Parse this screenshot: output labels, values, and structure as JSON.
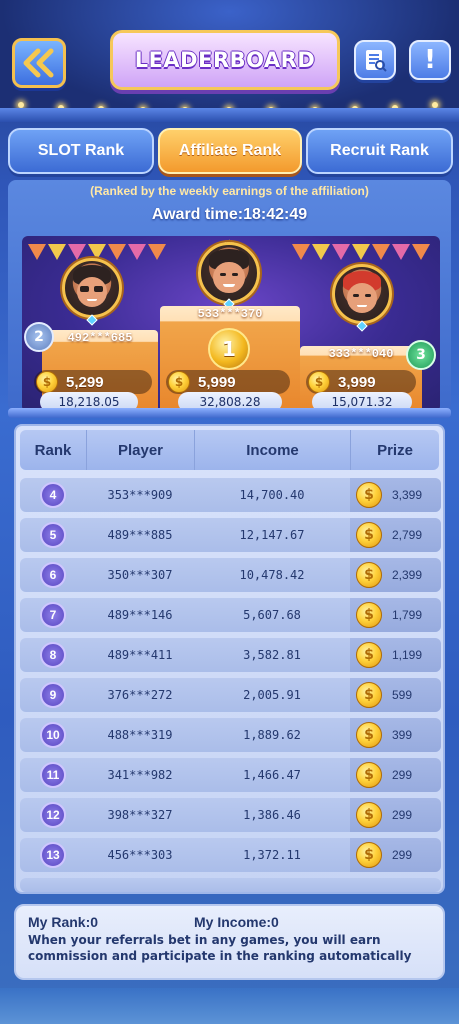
{
  "header": {
    "title": "LEADERBOARD",
    "back_icon": "double-chevron-left-icon",
    "rules_icon": "rules-list-icon",
    "info_icon": "exclamation-icon"
  },
  "tabs": [
    {
      "label": "SLOT Rank",
      "active": false
    },
    {
      "label": "Affiliate Rank",
      "active": true
    },
    {
      "label": "Recruit Rank",
      "active": false
    }
  ],
  "subtitle": "(Ranked by the weekly earnings of the affiliation)",
  "award_time": "Award time:18:42:49",
  "podium": {
    "first": {
      "rank": "1",
      "player": "533***370",
      "prize": "5,999",
      "income": "32,808.28"
    },
    "second": {
      "rank": "2",
      "player": "492***685",
      "prize": "5,299",
      "income": "18,218.05"
    },
    "third": {
      "rank": "3",
      "player": "333***040",
      "prize": "3,999",
      "income": "15,071.32"
    }
  },
  "table": {
    "headers": {
      "rank": "Rank",
      "player": "Player",
      "income": "Income",
      "prize": "Prize"
    },
    "rows": [
      {
        "rank": "4",
        "player": "353***909",
        "income": "14,700.40",
        "prize": "3,399"
      },
      {
        "rank": "5",
        "player": "489***885",
        "income": "12,147.67",
        "prize": "2,799"
      },
      {
        "rank": "6",
        "player": "350***307",
        "income": "10,478.42",
        "prize": "2,399"
      },
      {
        "rank": "7",
        "player": "489***146",
        "income": "5,607.68",
        "prize": "1,799"
      },
      {
        "rank": "8",
        "player": "489***411",
        "income": "3,582.81",
        "prize": "1,199"
      },
      {
        "rank": "9",
        "player": "376***272",
        "income": "2,005.91",
        "prize": "599"
      },
      {
        "rank": "10",
        "player": "488***319",
        "income": "1,889.62",
        "prize": "399"
      },
      {
        "rank": "11",
        "player": "341***982",
        "income": "1,466.47",
        "prize": "299"
      },
      {
        "rank": "12",
        "player": "398***327",
        "income": "1,386.46",
        "prize": "299"
      },
      {
        "rank": "13",
        "player": "456***303",
        "income": "1,372.11",
        "prize": "299"
      }
    ]
  },
  "footer": {
    "my_rank": "My Rank:0",
    "my_income": "My Income:0",
    "note": "When your referrals bet in any games, you will earn commission and participate in the ranking automatically"
  },
  "colors": {
    "active_tab": "#f39a2d",
    "tab": "#3c6bd4",
    "coin": "#ffd23b",
    "rank_circle": "#5846c2"
  }
}
